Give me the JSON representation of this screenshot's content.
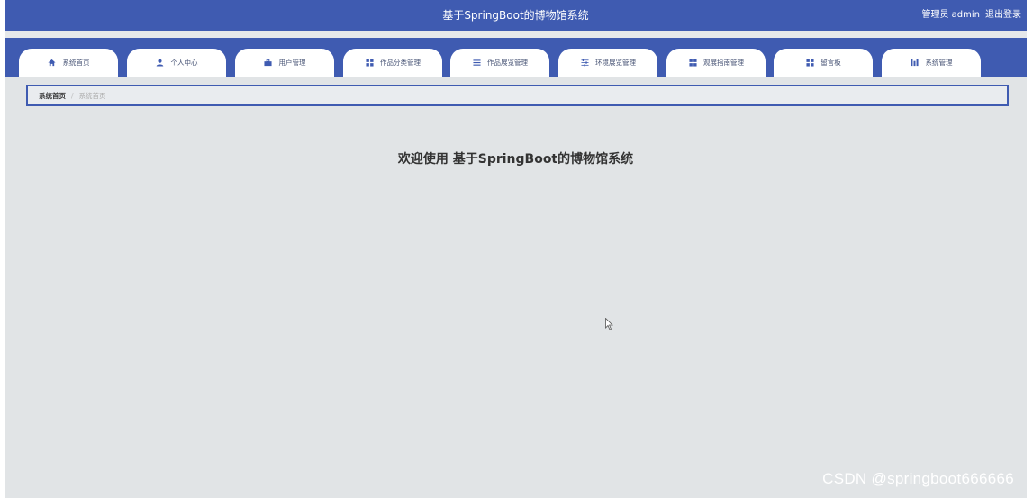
{
  "header": {
    "title": "基于SpringBoot的博物馆系统",
    "user_label": "管理员 admin",
    "logout_label": "退出登录"
  },
  "nav": {
    "items": [
      {
        "label": "系统首页",
        "icon": "home-icon"
      },
      {
        "label": "个人中心",
        "icon": "user-icon"
      },
      {
        "label": "用户管理",
        "icon": "briefcase-icon"
      },
      {
        "label": "作品分类管理",
        "icon": "grid-icon"
      },
      {
        "label": "作品展览管理",
        "icon": "list-icon"
      },
      {
        "label": "环境展览管理",
        "icon": "sliders-icon"
      },
      {
        "label": "观展指南管理",
        "icon": "grid-icon"
      },
      {
        "label": "留言板",
        "icon": "grid-icon"
      },
      {
        "label": "系统管理",
        "icon": "chart-icon"
      }
    ]
  },
  "breadcrumb": {
    "home": "系统首页",
    "current": "系统首页"
  },
  "main": {
    "welcome": "欢迎使用 基于SpringBoot的博物馆系统"
  },
  "watermark": "CSDN @springboot666666",
  "colors": {
    "primary": "#3f5bb1",
    "background": "#e1e4e6"
  }
}
